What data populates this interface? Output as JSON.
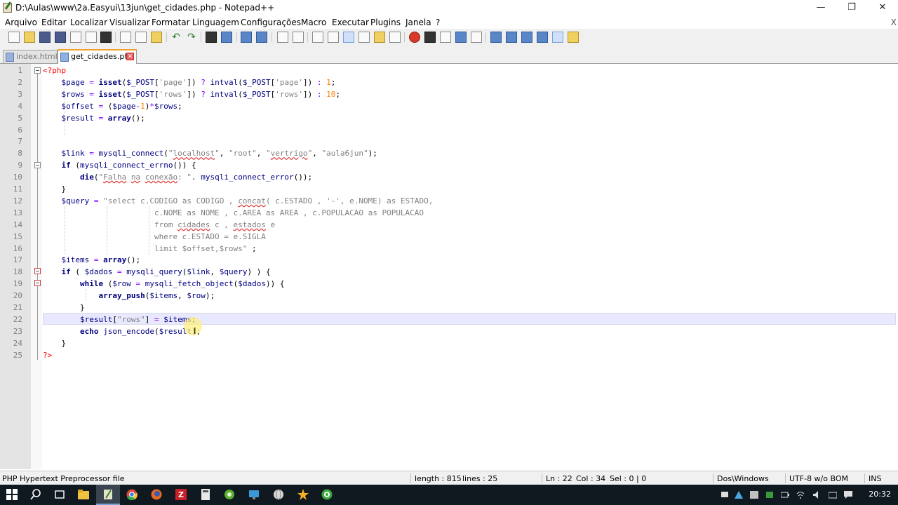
{
  "window": {
    "title": "D:\\Aulas\\www\\2a.Easyui\\13jun\\get_cidades.php - Notepad++",
    "minimize": "—",
    "maximize": "❐",
    "close": "✕"
  },
  "menu": {
    "items": [
      "Arquivo",
      "Editar",
      "Localizar",
      "Visualizar",
      "Formatar",
      "Linguagem",
      "Configurações",
      "Macro",
      "Executar",
      "Plugins",
      "Janela",
      "?"
    ],
    "close_x": "X"
  },
  "tabs": [
    {
      "label": "index.html",
      "active": false
    },
    {
      "label": "get_cidades.php",
      "active": true
    }
  ],
  "editor": {
    "current_line": 22,
    "lines": [
      {
        "n": "1",
        "html": "<span class='t'>&lt;?php</span>"
      },
      {
        "n": "2",
        "html": "    <span class='v'>$page</span> <span class='o'>=</span> <span class='k'>isset</span>(<span class='v'>$_POST</span>[<span class='s'>'page'</span>]) <span class='o'>?</span> <span class='v'>intval</span>(<span class='v'>$_POST</span>[<span class='s'>'page'</span>]) <span class='o'>:</span> <span class='n'>1</span>;"
      },
      {
        "n": "3",
        "html": "    <span class='v'>$rows</span> <span class='o'>=</span> <span class='k'>isset</span>(<span class='v'>$_POST</span>[<span class='s'>'rows'</span>]) <span class='o'>?</span> <span class='v'>intval</span>(<span class='v'>$_POST</span>[<span class='s'>'rows'</span>]) <span class='o'>:</span> <span class='n'>10</span>;"
      },
      {
        "n": "4",
        "html": "    <span class='v'>$offset</span> <span class='o'>=</span> (<span class='v'>$page</span><span class='o'>-</span><span class='n'>1</span>)<span class='o'>*</span><span class='v'>$rows</span>;"
      },
      {
        "n": "5",
        "html": "    <span class='v'>$result</span> <span class='o'>=</span> <span class='k'>array</span>();"
      },
      {
        "n": "6",
        "html": ""
      },
      {
        "n": "7",
        "html": ""
      },
      {
        "n": "8",
        "html": "    <span class='v'>$link</span> <span class='o'>=</span> <span class='v'>mysqli_connect</span>(<span class='s'>\"<span class='err'>localhost</span>\"</span>, <span class='s'>\"root\"</span>, <span class='s'>\"<span class='err'>vertrigo</span>\"</span>, <span class='s'>\"aula6jun\"</span>);"
      },
      {
        "n": "9",
        "html": "    <span class='k'>if</span> (<span class='v'>mysqli_connect_errno</span>()) {"
      },
      {
        "n": "10",
        "html": "        <span class='k'>die</span>(<span class='s'>\"<span class='err'>Falha</span> <span class='err'>na</span> <span class='err'>conexão</span>: \"</span>. <span class='v'>mysqli_connect_error</span>());"
      },
      {
        "n": "11",
        "html": "    }"
      },
      {
        "n": "12",
        "html": "    <span class='v'>$query</span> <span class='o'>=</span> <span class='s'>\"select c.CODIGO as CODIGO , <span class='err'>concat</span>( c.ESTADO , '-', e.NOME) as ESTADO,</span>"
      },
      {
        "n": "13",
        "html": "<span class='s'>                        c.NOME as NOME , c.AREA as AREA , c.POPULACAO as POPULACAO</span>"
      },
      {
        "n": "14",
        "html": "<span class='s'>                        from <span class='err'>cidades</span> c , <span class='err'>estados</span> e</span>"
      },
      {
        "n": "15",
        "html": "<span class='s'>                        where c.ESTADO = e.SIGLA</span>"
      },
      {
        "n": "16",
        "html": "<span class='s'>                        limit $offset,$rows\"</span> ;"
      },
      {
        "n": "17",
        "html": "    <span class='v'>$items</span> <span class='o'>=</span> <span class='k'>array</span>();"
      },
      {
        "n": "18",
        "html": "    <span class='k'>if</span> ( <span class='v'>$dados</span> <span class='o'>=</span> <span class='v'>mysqli_query</span>(<span class='v'>$link</span>, <span class='v'>$query</span>) ) {"
      },
      {
        "n": "19",
        "html": "        <span class='k'>while</span> (<span class='v'>$row</span> <span class='o'>=</span> <span class='v'>mysqli_fetch_object</span>(<span class='v'>$dados</span>)) {"
      },
      {
        "n": "20",
        "html": "            <span class='k'>array_push</span>(<span class='v'>$items</span>, <span class='v'>$row</span>);"
      },
      {
        "n": "21",
        "html": "        }"
      },
      {
        "n": "22",
        "html": "        <span class='v'>$result</span>[<span class='s'>\"rows\"</span>] <span class='o'>=</span> <span class='v'>$items</span>;"
      },
      {
        "n": "23",
        "html": "        <span class='k'>echo</span> <span class='v'>json_encode</span>(<span class='v'>$result</span>);"
      },
      {
        "n": "24",
        "html": "    }"
      },
      {
        "n": "25",
        "html": "<span class='t'>?&gt;</span>"
      }
    ]
  },
  "status": {
    "file_type": "PHP Hypertext Preprocessor file",
    "length": "length : 815",
    "lines": "lines : 25",
    "ln": "Ln : 22",
    "col": "Col : 34",
    "sel": "Sel : 0 | 0",
    "eol": "Dos\\Windows",
    "encoding": "UTF-8 w/o BOM",
    "mode": "INS"
  },
  "taskbar": {
    "time": "20:32"
  },
  "colors": {
    "keyword": "#000080",
    "string": "#808080",
    "number": "#ff8000",
    "php_tag": "#ff0000",
    "operator": "#8000ff",
    "current_line": "#e8e8ff"
  }
}
